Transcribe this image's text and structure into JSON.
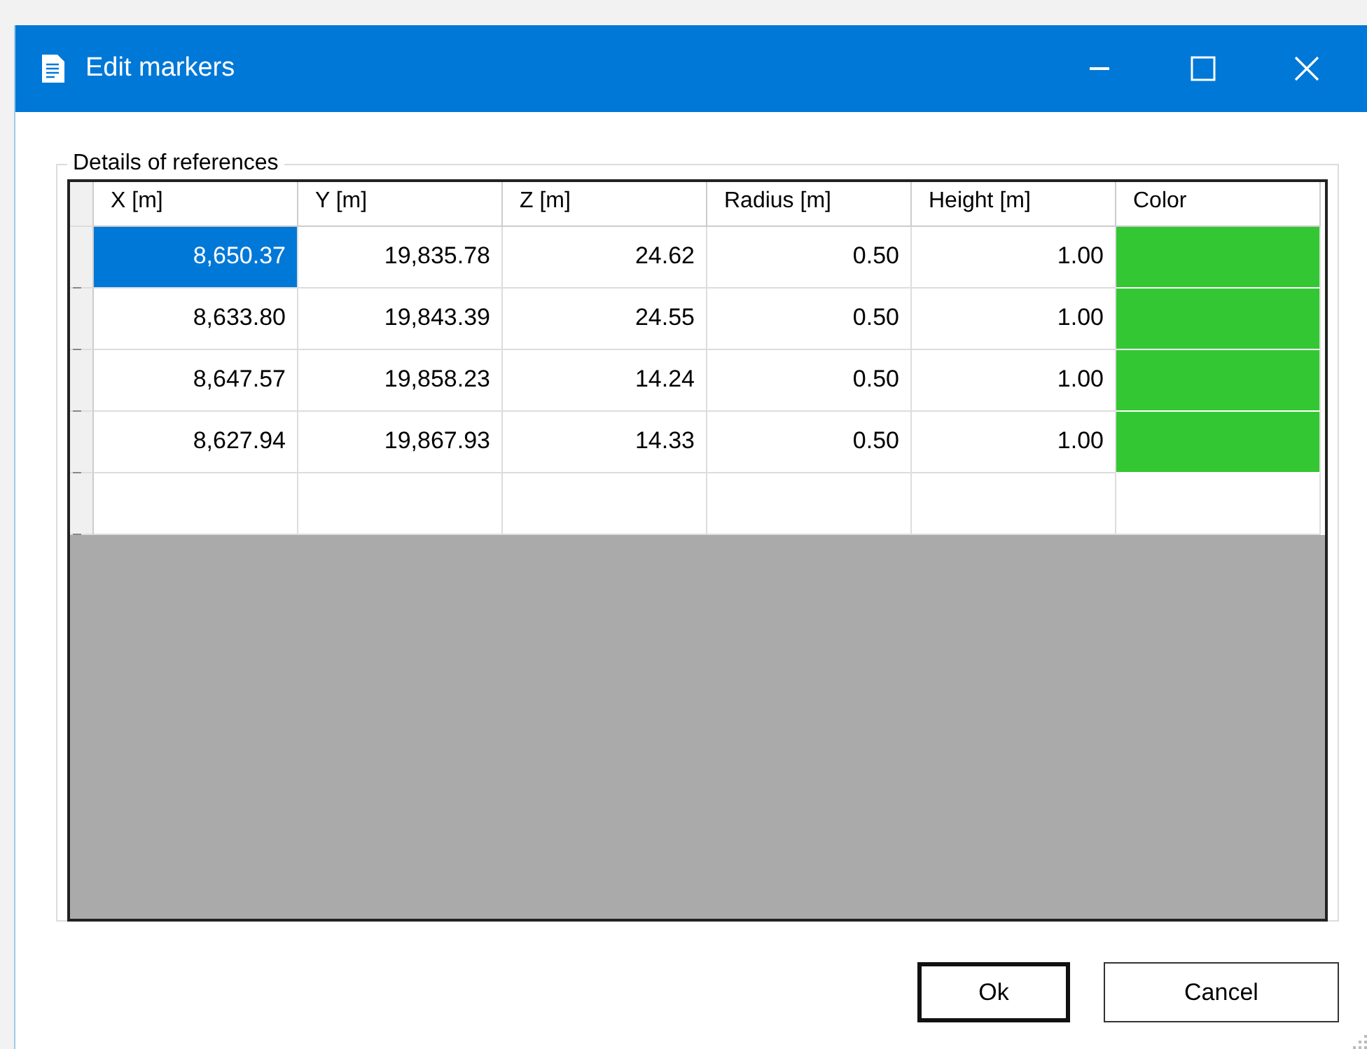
{
  "window": {
    "title": "Edit markers"
  },
  "group": {
    "title": "Details of references"
  },
  "table": {
    "columns": [
      "X [m]",
      "Y [m]",
      "Z [m]",
      "Radius [m]",
      "Height [m]",
      "Color"
    ],
    "rows": [
      {
        "kind": "data",
        "selected": true,
        "cells": [
          "8,650.37",
          "19,835.78",
          "24.62",
          "0.50",
          "1.00"
        ],
        "color": "#33c733"
      },
      {
        "kind": "data",
        "selected": false,
        "cells": [
          "8,633.80",
          "19,843.39",
          "24.55",
          "0.50",
          "1.00"
        ],
        "color": "#33c733"
      },
      {
        "kind": "data",
        "selected": false,
        "cells": [
          "8,647.57",
          "19,858.23",
          "14.24",
          "0.50",
          "1.00"
        ],
        "color": "#33c733"
      },
      {
        "kind": "data",
        "selected": false,
        "cells": [
          "8,627.94",
          "19,867.93",
          "14.33",
          "0.50",
          "1.00"
        ],
        "color": "#33c733"
      },
      {
        "kind": "new",
        "selected": false
      }
    ]
  },
  "buttons": [
    {
      "label": "Ok",
      "default": true
    },
    {
      "label": "Cancel",
      "default": false
    }
  ]
}
